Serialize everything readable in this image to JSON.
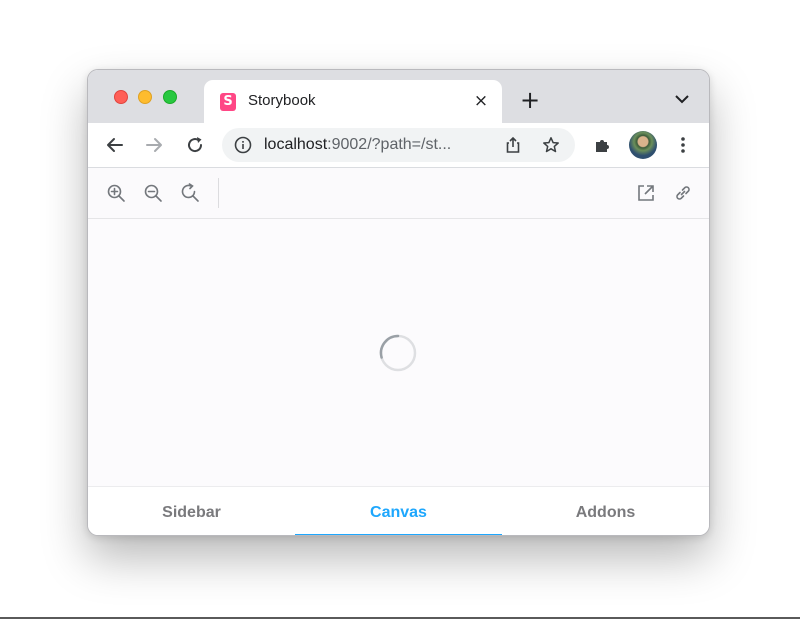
{
  "browser": {
    "tab": {
      "title": "Storybook",
      "favicon": "storybook-icon",
      "favicon_letter": "S"
    },
    "tab_close_glyph": "×",
    "new_tab_glyph": "+",
    "address": {
      "host": "localhost",
      "rest": ":9002/?path=/st..."
    }
  },
  "storybook_toolbar": {
    "icons": [
      "zoom-in-icon",
      "zoom-out-icon",
      "zoom-reset-icon",
      "open-new-tab-icon",
      "copy-link-icon"
    ]
  },
  "bottom_nav": {
    "tabs": [
      {
        "label": "Sidebar",
        "active": false
      },
      {
        "label": "Canvas",
        "active": true
      },
      {
        "label": "Addons",
        "active": false
      }
    ]
  },
  "colors": {
    "accent": "#1ea7fd",
    "storybook_pink": "#ff4785"
  }
}
